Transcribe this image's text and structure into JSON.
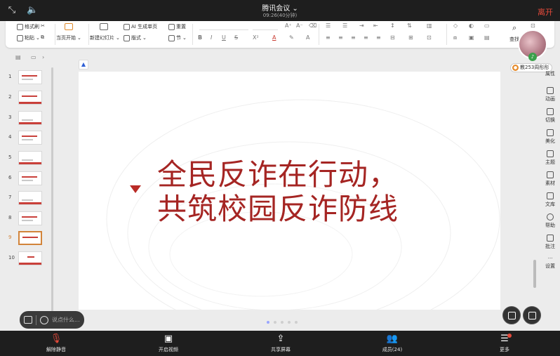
{
  "app": {
    "title": "腾讯会议",
    "timer": "09:26(40分钟)",
    "leave": "离开"
  },
  "ribbon": {
    "format_brush": "格式刷",
    "paste": "粘贴",
    "from_current": "当页开始",
    "new_slide": "新建幻灯片",
    "ai_generate": "AI 生成单页",
    "layout": "版式",
    "reset": "重置",
    "section": "节",
    "find": "查找",
    "bold": "B",
    "italic": "I",
    "underline": "U",
    "strike": "S",
    "superscript": "X²",
    "font_color": "A",
    "font_size_up": "A⁺",
    "font_size_down": "A⁻"
  },
  "participant": {
    "name": "教253周彤彤"
  },
  "thumbnails": {
    "items": [
      "1",
      "2",
      "3",
      "4",
      "5",
      "6",
      "7",
      "8",
      "9",
      "10"
    ],
    "selected_index": 9
  },
  "slide": {
    "line1": "全民反诈在行动，",
    "line2": "共筑校园反诈防线"
  },
  "right_panel": {
    "items": [
      "属性",
      "动画",
      "切换",
      "美化",
      "主题",
      "素材",
      "文库",
      "帮助",
      "批注",
      "设置"
    ]
  },
  "chat": {
    "placeholder": "说点什么..."
  },
  "bottom": {
    "mute": "解除静音",
    "video": "开启视频",
    "share": "共享屏幕",
    "members": "成员(24)",
    "more": "更多"
  },
  "icons": {
    "shrink": "shrink-icon",
    "speaker": "speaker-icon",
    "mic_off": "mic-off-icon",
    "camera_off": "camera-off-icon",
    "share_screen": "share-screen-icon",
    "members": "members-icon",
    "more": "menu-icon"
  },
  "colors": {
    "accent_red": "#a52523",
    "leave_red": "#e64a3b",
    "selected_thumb": "#d2843a"
  }
}
